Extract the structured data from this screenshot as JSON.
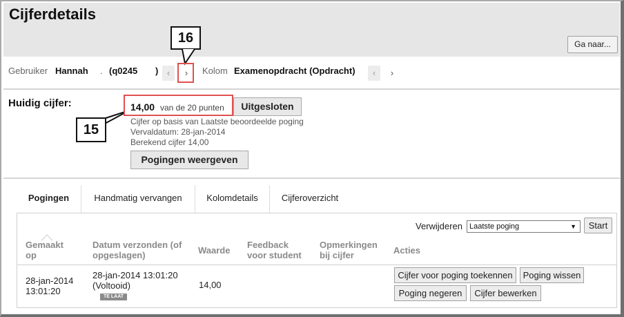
{
  "page_title": "Cijferdetails",
  "goto_button": "Ga naar...",
  "nav": {
    "user_label": "Gebruiker",
    "user_name": "Hannah",
    "user_dot": ".",
    "user_id": "(q0245",
    "user_close": ")",
    "prev_icon": "‹",
    "next_icon": "›",
    "column_label": "Kolom",
    "column_name": "Examenopdracht (Opdracht)"
  },
  "grade": {
    "label": "Huidig cijfer:",
    "value": "14,00",
    "out_of": "van de 20 punten",
    "excluded_button": "Uitgesloten",
    "basis": "Cijfer op basis van Laatste beoordeelde poging",
    "due_date": "Vervaldatum: 28-jan-2014",
    "calculated": "Berekend cijfer  14,00",
    "show_attempts_button": "Pogingen weergeven"
  },
  "callouts": {
    "c16": "16",
    "c15": "15"
  },
  "tabs": [
    {
      "label": "Pogingen"
    },
    {
      "label": "Handmatig vervangen"
    },
    {
      "label": "Kolomdetails"
    },
    {
      "label": "Cijferoverzicht"
    }
  ],
  "attempts": {
    "delete_label": "Verwijderen",
    "delete_selected": "Laatste poging",
    "start_button": "Start",
    "headers": {
      "made": [
        "Gemaakt",
        "op"
      ],
      "submitted": [
        "Datum verzonden (of",
        "opgeslagen)"
      ],
      "value": "Waarde",
      "feedback": [
        "Feedback",
        "voor student"
      ],
      "notes": [
        "Opmerkingen",
        "bij cijfer"
      ],
      "actions": "Acties"
    },
    "row": {
      "made": [
        "28-jan-2014",
        "13:01:20"
      ],
      "submitted": [
        "28-jan-2014 13:01:20",
        "(Voltooid)"
      ],
      "late_badge": "TE LAAT",
      "value": "14,00",
      "actions": {
        "grade": "Cijfer voor poging toekennen",
        "clear": "Poging wissen",
        "ignore": "Poging negeren",
        "edit": "Cijfer bewerken"
      }
    }
  }
}
